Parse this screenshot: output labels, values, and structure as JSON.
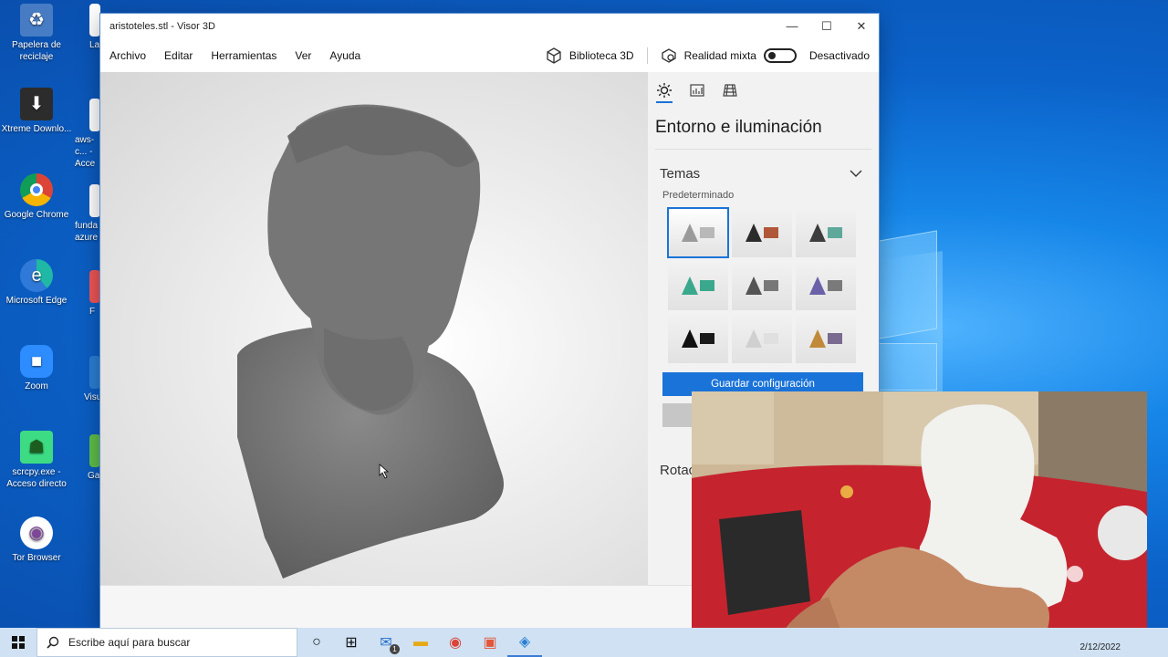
{
  "desktop": {
    "icons": [
      {
        "name": "recycle-bin",
        "label": "Papelera de reciclaje"
      },
      {
        "name": "xtreme-download",
        "label": "Xtreme Downlo..."
      },
      {
        "name": "google-chrome",
        "label": "Google Chrome"
      },
      {
        "name": "microsoft-edge",
        "label": "Microsoft Edge"
      },
      {
        "name": "zoom",
        "label": "Zoom"
      },
      {
        "name": "scrcpy",
        "label": "scrcpy.exe - Acceso directo"
      },
      {
        "name": "tor-browser",
        "label": "Tor Browser"
      }
    ],
    "partial_icons": [
      {
        "label": "La"
      },
      {
        "label": "aws-c... - Acce"
      },
      {
        "label": "funda azure"
      },
      {
        "label": "F"
      },
      {
        "label": "Visu"
      },
      {
        "label": "Gar"
      }
    ]
  },
  "window": {
    "title": "aristoteles.stl - Visor 3D",
    "controls": {
      "minimize": "—",
      "maximize": "☐",
      "close": "✕"
    },
    "menu": [
      "Archivo",
      "Editar",
      "Herramientas",
      "Ver",
      "Ayuda"
    ],
    "library_label": "Biblioteca 3D",
    "mixed_reality_label": "Realidad mixta",
    "mixed_reality_state": "Desactivado"
  },
  "panel": {
    "title": "Entorno e iluminación",
    "section": "Temas",
    "preset_label": "Predeterminado",
    "themes": [
      {
        "cone": "#9a9a9a",
        "box": "#b8b8b8",
        "bg": "#ffffff"
      },
      {
        "cone": "#2b2b2b",
        "box": "#b0573a",
        "bg": "#f2f2f2"
      },
      {
        "cone": "#3d3d3d",
        "box": "#5fa89a",
        "bg": "#f2f2f2"
      },
      {
        "cone": "#3aa88c",
        "box": "#3aa88c",
        "bg": "#f2f2f2"
      },
      {
        "cone": "#555555",
        "box": "#777777",
        "bg": "#f2f2f2"
      },
      {
        "cone": "#6a62a8",
        "box": "#7a7a7a",
        "bg": "#f2f2f2"
      },
      {
        "cone": "#111111",
        "box": "#1a1a1a",
        "bg": "#f2f2f2"
      },
      {
        "cone": "#d0d0d0",
        "box": "#e0e0e0",
        "bg": "#f2f2f2"
      },
      {
        "cone": "#c08a3a",
        "box": "#7a6a90",
        "bg": "#f2f2f2"
      }
    ],
    "selected_theme": 0,
    "save_label": "Guardar configuración",
    "rotation_label": "Rotac"
  },
  "taskbar": {
    "search_placeholder": "Escribe aquí para buscar",
    "date": "2/12/2022",
    "mail_badge": "1"
  },
  "colors": {
    "accent": "#1a73d9",
    "desktop": "#0b62c9"
  }
}
